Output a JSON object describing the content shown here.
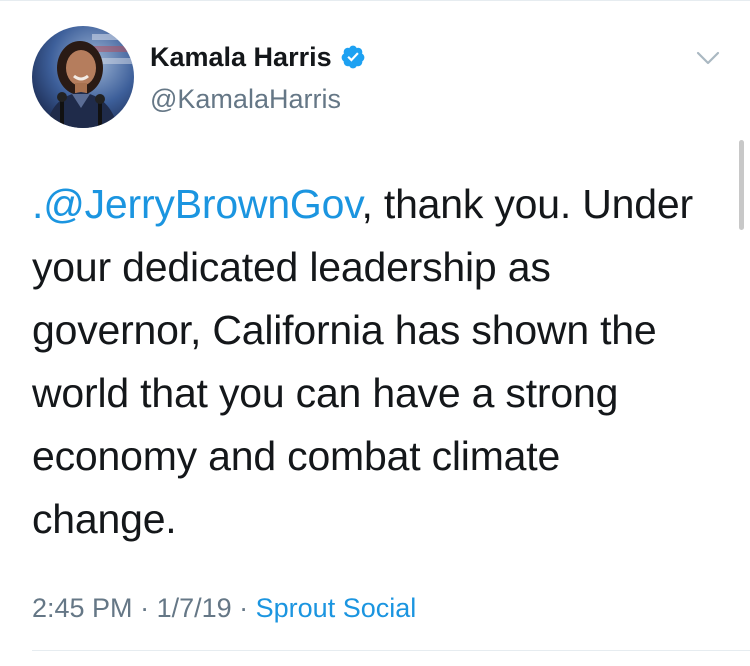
{
  "author": {
    "display_name": "Kamala Harris",
    "handle": "@KamalaHarris",
    "verified": true,
    "avatar_icon": "profile-photo",
    "verified_icon": "verified-badge-icon"
  },
  "header": {
    "menu_icon": "chevron-down-icon"
  },
  "tweet": {
    "mention": ".@JerryBrownGov",
    "text_line_1": ", thank you. Under",
    "text_line_2": "your dedicated leadership as",
    "text_line_3": "governor, California has shown the",
    "text_line_4": "world that you can have a strong",
    "text_line_5": "economy and combat climate",
    "text_line_6": "change."
  },
  "meta": {
    "time": "2:45 PM",
    "separator": " · ",
    "date": "1/7/19",
    "source": "Sprout Social"
  },
  "colors": {
    "link": "#1b95e0",
    "secondary_text": "#657786",
    "primary_text": "#14171a",
    "verified_badge": "#1da1f2"
  }
}
